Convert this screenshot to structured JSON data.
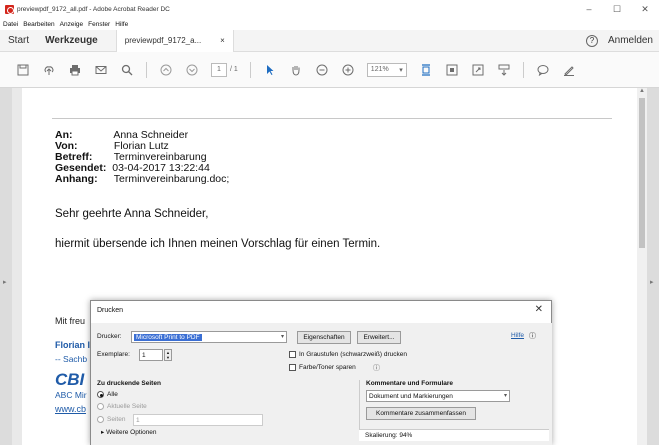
{
  "window": {
    "title": "previewpdf_9172_all.pdf - Adobe Acrobat Reader DC",
    "minimize": "–",
    "maximize": "☐",
    "close": "✕"
  },
  "menu": [
    "Datei",
    "Bearbeiten",
    "Anzeige",
    "Fenster",
    "Hilfe"
  ],
  "tabs": {
    "start": "Start",
    "tools": "Werkzeuge",
    "document": "previewpdf_9172_a...",
    "document_close": "×",
    "help": "?",
    "signin": "Anmelden"
  },
  "toolbar": {
    "page_current": "1",
    "page_count": "/ 1",
    "zoom": "121%"
  },
  "email": {
    "to_label": "An:",
    "to": "Anna Schneider",
    "from_label": "Von:",
    "from": "Florian Lutz",
    "subject_label": "Betreff:",
    "subject": "Terminvereinbarung",
    "sent_label": "Gesendet:",
    "sent": "03-04-2017 13:22:44",
    "attachment_label": "Anhang:",
    "attachment": "Terminvereinbarung.doc;",
    "greeting": "Sehr geehrte Anna Schneider,",
    "body": "hiermit übersende ich Ihnen meinen Vorschlag für einen Termin.",
    "partial_closing": "Mit freu",
    "partial_name": "Florian l",
    "partial_title": "-- Sachb",
    "partial_logo": "CBI",
    "partial_company": "ABC Mir",
    "partial_web": "www.cb"
  },
  "print_dialog": {
    "title": "Drucken",
    "close": "✕",
    "printer_label": "Drucker:",
    "printer_value": "Microsoft Print to PDF",
    "properties_button": "Eigenschaften",
    "advanced_button": "Erweitert...",
    "help_link": "Hilfe",
    "copies_label": "Exemplare:",
    "copies_value": "1",
    "grayscale_label": "In Graustufen (schwarzweiß) drucken",
    "save_toner_label": "Farbe/Toner sparen",
    "pages_section_title": "Zu druckende Seiten",
    "option_all": "Alle",
    "option_current": "Aktuelle Seite",
    "option_pages": "Seiten",
    "pages_value": "1",
    "more_options": "Weitere Optionen",
    "comments_section_title": "Kommentare und Formulare",
    "comments_value": "Dokument und Markierungen",
    "summarize_button": "Kommentare zusammenfassen",
    "scale_text": "Skalierung: 94%"
  }
}
